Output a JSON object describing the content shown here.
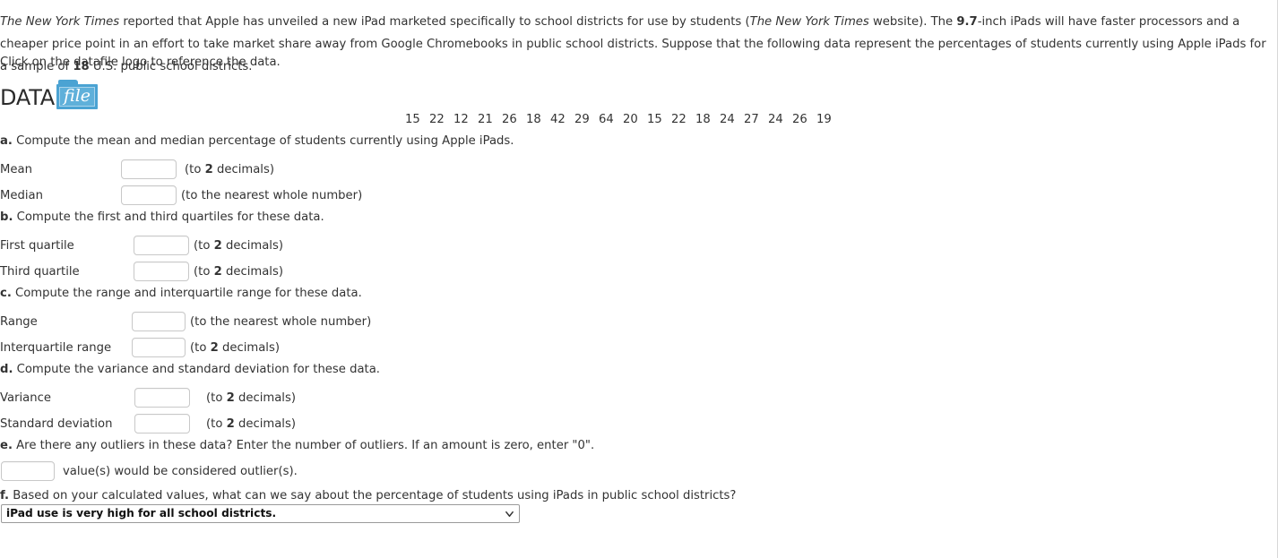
{
  "intro": {
    "part1_italic": "The New York Times",
    "part1": " reported that Apple has unveiled a new iPad marketed specifically to school districts for use by students (",
    "part2_italic": "The New York Times",
    "part2": " website). The ",
    "bold1": "9.7",
    "part3": "-inch iPads will have faster processors and a cheaper price point in an effort to take market share away from Google Chromebooks in public school districts. Suppose that the following data represent the percentages of students currently using Apple iPads for a sample of ",
    "bold2": "18",
    "part4": " U.S. public school districts."
  },
  "click_note": "Click on the datafile logo to reference the data.",
  "datafile_logo": {
    "word": "DATA",
    "folder_text": "file"
  },
  "data_values": [
    15,
    22,
    12,
    21,
    26,
    18,
    42,
    29,
    64,
    20,
    15,
    22,
    18,
    24,
    27,
    24,
    26,
    19
  ],
  "parts": {
    "a": {
      "letter": "a.",
      "text": " Compute the mean and median percentage of students currently using Apple iPads.",
      "fields": [
        {
          "name": "Mean",
          "value": "",
          "hint_pre": "(to ",
          "hint_bold": "2",
          "hint_post": " decimals)"
        },
        {
          "name": "Median",
          "value": "",
          "hint_pre": "(to the nearest whole number)",
          "hint_bold": "",
          "hint_post": ""
        }
      ]
    },
    "b": {
      "letter": "b.",
      "text": " Compute the first and third quartiles for these data.",
      "fields": [
        {
          "name": "First quartile",
          "value": "",
          "hint_pre": "(to ",
          "hint_bold": "2",
          "hint_post": " decimals)"
        },
        {
          "name": "Third quartile",
          "value": "",
          "hint_pre": "(to ",
          "hint_bold": "2",
          "hint_post": " decimals)"
        }
      ]
    },
    "c": {
      "letter": "c.",
      "text": " Compute the range and interquartile range for these data.",
      "fields": [
        {
          "name": "Range",
          "value": "",
          "hint_pre": "(to the nearest whole number)",
          "hint_bold": "",
          "hint_post": ""
        },
        {
          "name": "Interquartile range",
          "value": "",
          "hint_pre": "(to ",
          "hint_bold": "2",
          "hint_post": " decimals)"
        }
      ]
    },
    "d": {
      "letter": "d.",
      "text": " Compute the variance and standard deviation for these data.",
      "fields": [
        {
          "name": "Variance",
          "value": "",
          "hint_pre": "(to ",
          "hint_bold": "2",
          "hint_post": " decimals)"
        },
        {
          "name": "Standard deviation",
          "value": "",
          "hint_pre": "(to ",
          "hint_bold": "2",
          "hint_post": " decimals)"
        }
      ]
    },
    "e": {
      "letter": "e.",
      "text": " Are there any outliers in these data? Enter the number of outliers. If an amount is zero, enter \"0\".",
      "outlier_value": "",
      "outlier_suffix": "value(s) would be considered outlier(s)."
    },
    "f": {
      "letter": "f.",
      "text": " Based on your calculated values, what can we say about the percentage of students using iPads in public school districts?",
      "selected": "iPad use is very high for all school districts.",
      "options": [
        "iPad use is very high for all school districts."
      ]
    }
  }
}
